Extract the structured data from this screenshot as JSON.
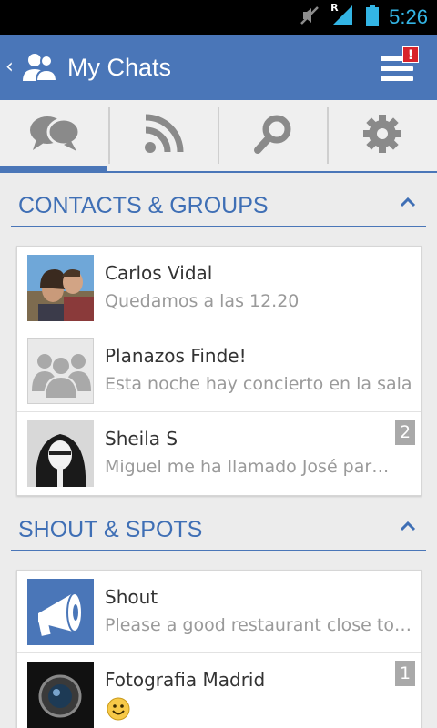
{
  "status_bar": {
    "time": "5:26",
    "icons": [
      "mute-icon",
      "signal-icon",
      "battery-icon"
    ],
    "roaming_label": "R",
    "accent": "#33b5e5"
  },
  "action_bar": {
    "back_glyph": "‹",
    "title": "My Chats",
    "menu_badge": "!",
    "color": "#4a76b8"
  },
  "tabs": [
    {
      "icon": "chat-bubbles-icon",
      "active": true
    },
    {
      "icon": "rss-feed-icon",
      "active": false
    },
    {
      "icon": "search-icon",
      "active": false
    },
    {
      "icon": "gear-icon",
      "active": false
    }
  ],
  "sections": {
    "contacts": {
      "title": "CONTACTS & GROUPS",
      "chevron": "^",
      "items": [
        {
          "name": "Carlos Vidal",
          "message": "Quedamos a las 12.20",
          "avatar": "couple-photo",
          "unread": ""
        },
        {
          "name": "Planazos Finde!",
          "message": "Esta noche hay concierto en la sala",
          "avatar": "group-placeholder-icon",
          "unread": ""
        },
        {
          "name": "Sheila S",
          "message": "Miguel me ha llamado José par…",
          "avatar": "bw-portrait-photo",
          "unread": "2"
        }
      ]
    },
    "shouts": {
      "title": "SHOUT & SPOTS",
      "chevron": "^",
      "items": [
        {
          "name": "Shout",
          "message": "Please a good restaurant close to…",
          "avatar": "megaphone-icon",
          "unread": ""
        },
        {
          "name": "Fotografia Madrid",
          "message": "",
          "emoji": "smiley-emoji",
          "avatar": "camera-lens-photo",
          "unread": "1"
        }
      ]
    }
  }
}
